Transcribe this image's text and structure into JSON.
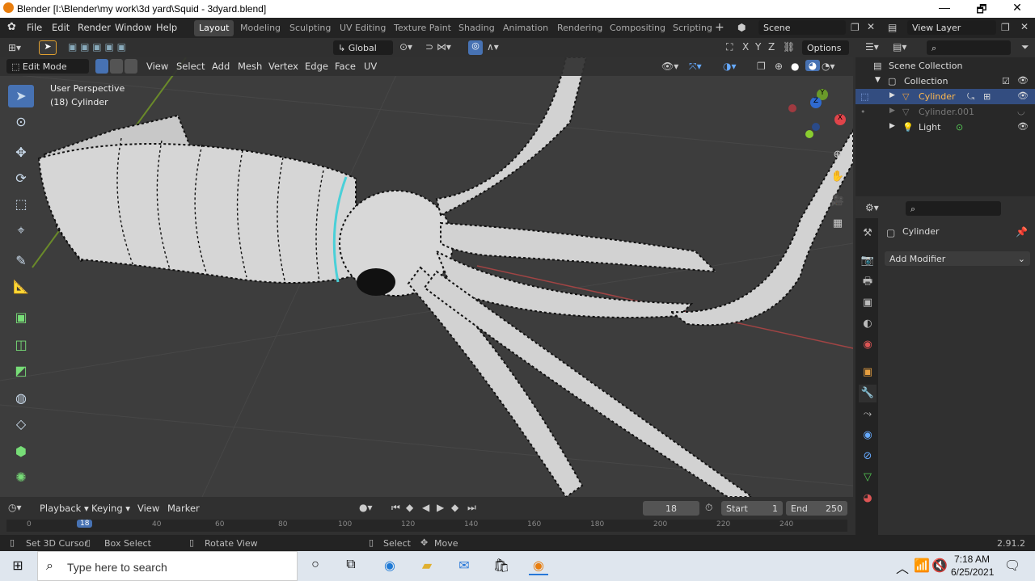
{
  "window": {
    "title": "Blender [I:\\Blender\\my work\\3d yard\\Squid - 3dyard.blend]",
    "minimize": "—",
    "maximize": "🗗",
    "close": "✕"
  },
  "menu": [
    "File",
    "Edit",
    "Render",
    "Window",
    "Help"
  ],
  "workspaces": [
    "Layout",
    "Modeling",
    "Sculpting",
    "UV Editing",
    "Texture Paint",
    "Shading",
    "Animation",
    "Rendering",
    "Compositing",
    "Scripting"
  ],
  "scene": {
    "label": "Scene"
  },
  "view_layer": {
    "label": "View Layer"
  },
  "viewport_header": {
    "transform_orientation": "Global",
    "options": "Options",
    "axes": [
      "X",
      "Y",
      "Z"
    ],
    "mode": "Edit Mode",
    "menus": [
      "View",
      "Select",
      "Add",
      "Mesh",
      "Vertex",
      "Edge",
      "Face",
      "UV"
    ]
  },
  "viewport_info": {
    "perspective": "User Perspective",
    "object": "(18) Cylinder"
  },
  "gizmo": {
    "x": "X",
    "y": "Y",
    "z": "Z"
  },
  "outliner": {
    "scene_collection": "Scene Collection",
    "collection": "Collection",
    "items": [
      "Cylinder",
      "Cylinder.001",
      "Light"
    ]
  },
  "properties": {
    "object_name": "Cylinder",
    "add_modifier": "Add Modifier"
  },
  "timeline": {
    "menus": [
      "Playback",
      "Keying",
      "View",
      "Marker"
    ],
    "current_frame": "18",
    "start_label": "Start",
    "start": "1",
    "end_label": "End",
    "end": "250",
    "ticks": [
      "0",
      "18",
      "40",
      "60",
      "80",
      "100",
      "120",
      "140",
      "160",
      "180",
      "200",
      "220",
      "240"
    ]
  },
  "statusbar": {
    "items": [
      "Set 3D Cursor",
      "Box Select",
      "Rotate View",
      "Select",
      "Move"
    ],
    "version": "2.91.2"
  },
  "taskbar": {
    "search_placeholder": "Type here to search",
    "time": "7:18 AM",
    "date": "6/25/2021"
  }
}
